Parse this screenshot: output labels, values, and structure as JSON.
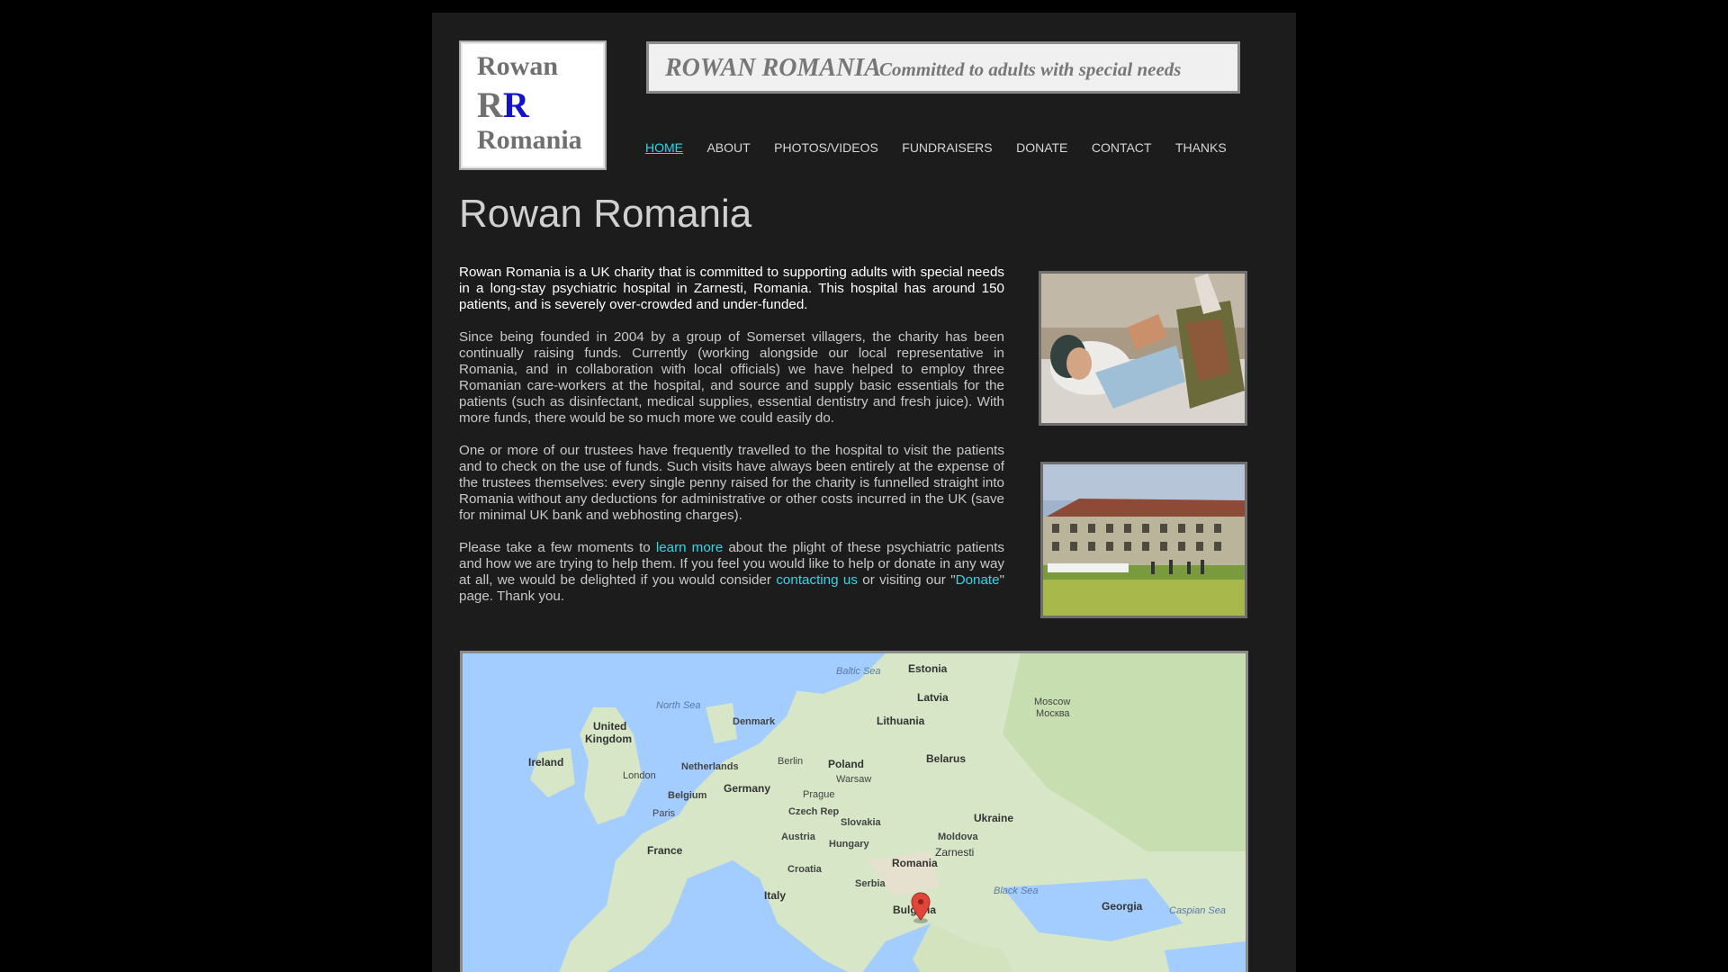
{
  "logo": {
    "line1": "Rowan",
    "line2a": "R",
    "line2b": "R",
    "line3": "Romania"
  },
  "banner": {
    "title": "ROWAN ROMANIA",
    "subtitle": "Committed to adults with special needs"
  },
  "nav": {
    "items": [
      {
        "label": "HOME",
        "active": true
      },
      {
        "label": "ABOUT"
      },
      {
        "label": "PHOTOS/VIDEOS"
      },
      {
        "label": "FUNDRAISERS"
      },
      {
        "label": "DONATE"
      },
      {
        "label": "CONTACT"
      },
      {
        "label": "THANKS"
      }
    ]
  },
  "page": {
    "title": "Rowan Romania",
    "p1": "Rowan Romania is a UK charity that is committed to supporting adults with special needs in a long-stay psychiatric hospital in Zarnesti, Romania. This hospital has around 150 patients, and is severely over-crowded and under-funded.",
    "p2": "Since being founded in 2004 by a group of Somerset villagers, the charity has been continually raising funds. Currently (working alongside our local representative in Romania, and in collaboration with local officials) we have helped to employ three Romanian care-workers at the hospital, and source and supply basic essentials for the patients (such as disinfectant, medical supplies, essential dentistry and fresh juice). With more funds, there would be so much more we could easily do.",
    "p3": "One or more of our trustees have frequently travelled to the hospital to visit the patients and to check on the use of funds. Such visits have always been entirely at the expense of the trustees themselves: every single penny raised for the charity is funnelled straight into Romania without any deductions for administrative or other costs incurred in the UK (save for minimal UK bank and webhosting charges).",
    "p4": {
      "t1": "Please take a few moments to ",
      "link1": "learn more",
      "t2": " about the plight of these psychiatric patients and how we are trying to help them. If you feel you would like to help or donate in any way at all, we would be delighted if you would consider ",
      "link2": "contacting us",
      "t3": " or visiting our \"",
      "link3": "Donate",
      "t4": "\" page. Thank you."
    }
  },
  "map": {
    "labels": {
      "estonia": "Estonia",
      "baltic": "Baltic Sea",
      "latvia": "Latvia",
      "north_sea": "North Sea",
      "denmark": "Denmark",
      "lithuania": "Lithuania",
      "moscow": "Moscow",
      "moscow_ru": "Москва",
      "uk": "United",
      "uk2": "Kingdom",
      "ireland": "Ireland",
      "netherlands": "Netherlands",
      "berlin": "Berlin",
      "poland": "Poland",
      "belarus": "Belarus",
      "london": "London",
      "warsaw": "Warsaw",
      "germany": "Germany",
      "belgium": "Belgium",
      "prague": "Prague",
      "czech": "Czech Rep",
      "paris": "Paris",
      "slovakia": "Slovakia",
      "ukraine": "Ukraine",
      "austria": "Austria",
      "hungary": "Hungary",
      "moldova": "Moldova",
      "france": "France",
      "zarnesti": "Zarnesti",
      "romania": "Romania",
      "croatia": "Croatia",
      "serbia": "Serbia",
      "black_sea": "Black Sea",
      "italy": "Italy",
      "bulgaria": "Bulgaria",
      "georgia": "Georgia",
      "caspian": "Caspian Sea"
    }
  },
  "colors": {
    "accent": "#2ad9e8",
    "logo_blue": "#1212cc",
    "page_bg": "#1c1c1c"
  },
  "icons": {
    "marker": "map-pin-icon"
  }
}
